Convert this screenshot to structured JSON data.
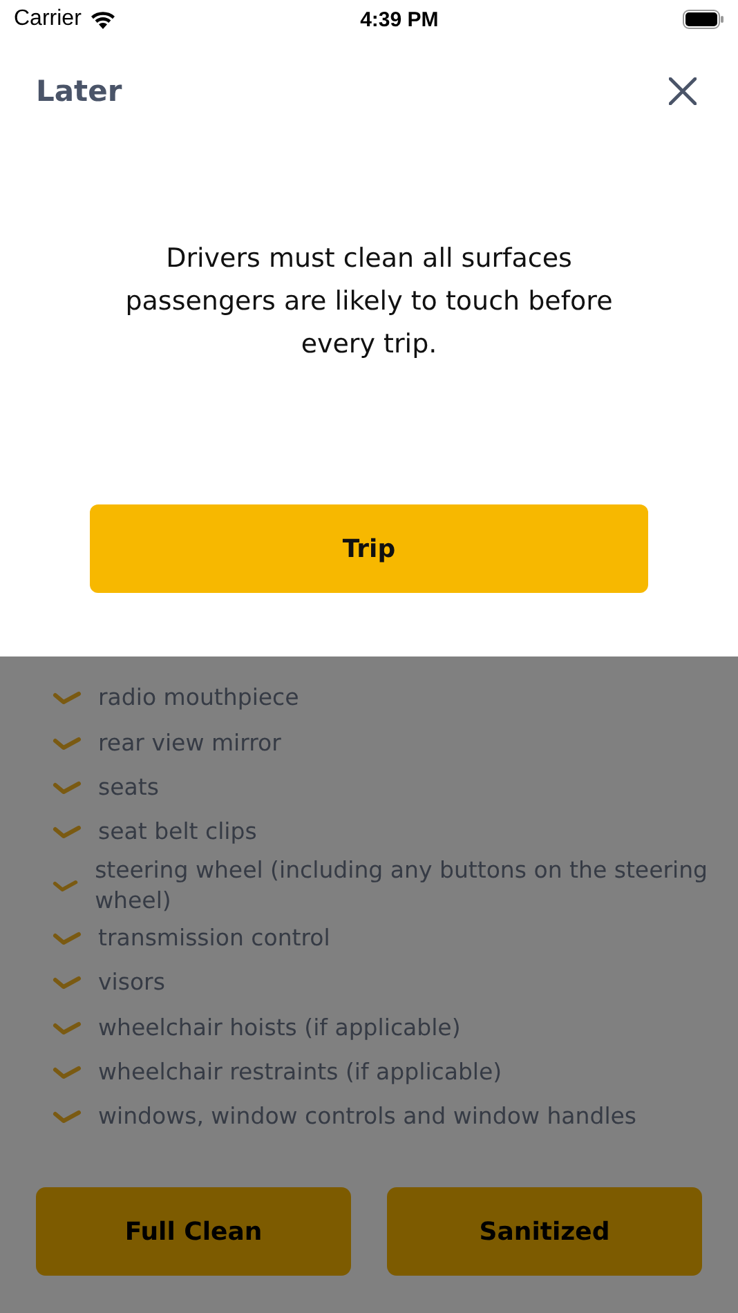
{
  "status_bar": {
    "carrier": "Carrier",
    "time": "4:39 PM"
  },
  "sheet": {
    "title": "Later",
    "message": "Drivers must clean all surfaces passengers are likely to touch before every trip.",
    "button": "Trip"
  },
  "checklist": [
    {
      "text": "radio mouthpiece"
    },
    {
      "text": "rear view mirror"
    },
    {
      "text": "seats"
    },
    {
      "text": "seat belt clips"
    },
    {
      "text": "steering wheel (including any buttons on the steering wheel)"
    },
    {
      "text": "transmission control"
    },
    {
      "text": "visors"
    },
    {
      "text": "wheelchair hoists (if applicable)"
    },
    {
      "text": "wheelchair restraints (if applicable)"
    },
    {
      "text": "windows, window controls and window handles"
    }
  ],
  "buttons": [
    "Full Clean",
    "Sanitized"
  ]
}
